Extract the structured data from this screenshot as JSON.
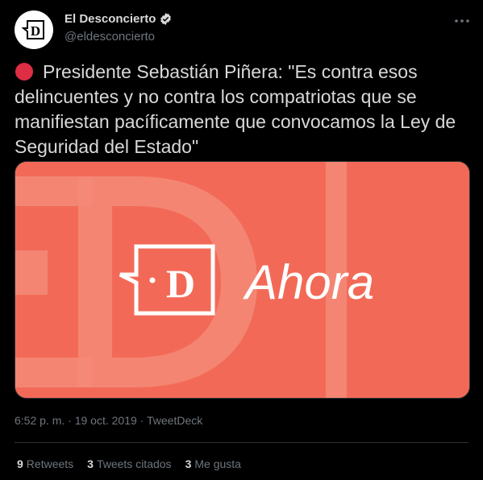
{
  "author": {
    "name": "El Desconcierto",
    "handle": "@eldesconcierto",
    "avatar_letter": "D",
    "verified_icon": "verified-badge-icon"
  },
  "tweet": {
    "status_icon": "red-circle-emoji",
    "text": "Presidente Sebastián Piñera: \"Es contra esos delincuentes y no contra los compatriotas que se manifiestan pacíficamente que convocamos la Ley de Seguridad del Estado\"",
    "time": "6:52 p. m.",
    "separator": "·",
    "date": "19 oct. 2019",
    "source": "TweetDeck"
  },
  "media": {
    "logo_letter": "D",
    "caption": "Ahora",
    "background_color": "#f26a57"
  },
  "stats": {
    "retweets_count": "9",
    "retweets_label": "Retweets",
    "quotes_count": "3",
    "quotes_label": "Tweets citados",
    "likes_count": "3",
    "likes_label": "Me gusta"
  },
  "colors": {
    "background": "#000000",
    "text": "#d9d9d9",
    "secondary": "#6e767d",
    "divider": "#2f3336",
    "verified": "#d9d9d9"
  }
}
